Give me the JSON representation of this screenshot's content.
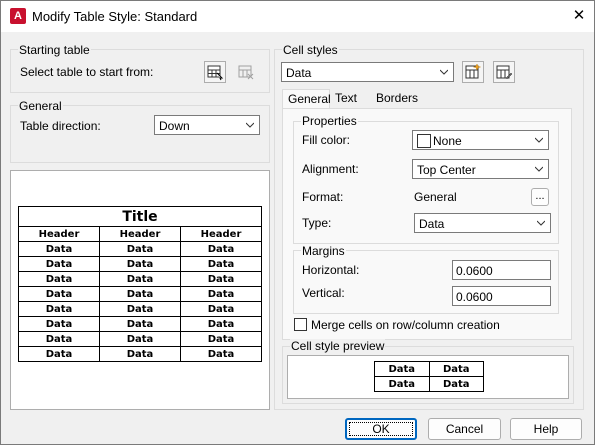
{
  "window": {
    "title": "Modify Table Style: Standard",
    "app_icon_letter": "A",
    "close_glyph": "✕"
  },
  "starting_table": {
    "group_label": "Starting table",
    "select_label": "Select table to start from:"
  },
  "general": {
    "group_label": "General",
    "direction_label": "Table direction:",
    "direction_value": "Down"
  },
  "preview": {
    "title": "Title",
    "headers": [
      "Header",
      "Header",
      "Header"
    ],
    "rows": [
      [
        "Data",
        "Data",
        "Data"
      ],
      [
        "Data",
        "Data",
        "Data"
      ],
      [
        "Data",
        "Data",
        "Data"
      ],
      [
        "Data",
        "Data",
        "Data"
      ],
      [
        "Data",
        "Data",
        "Data"
      ],
      [
        "Data",
        "Data",
        "Data"
      ],
      [
        "Data",
        "Data",
        "Data"
      ],
      [
        "Data",
        "Data",
        "Data"
      ]
    ]
  },
  "cell_styles": {
    "group_label": "Cell styles",
    "selected": "Data",
    "tabs": [
      "General",
      "Text",
      "Borders"
    ],
    "active_tab": "General"
  },
  "properties": {
    "group_label": "Properties",
    "fill_color_label": "Fill color:",
    "fill_color_value": "None",
    "alignment_label": "Alignment:",
    "alignment_value": "Top Center",
    "format_label": "Format:",
    "format_value": "General",
    "format_button": "...",
    "type_label": "Type:",
    "type_value": "Data"
  },
  "margins": {
    "group_label": "Margins",
    "horizontal_label": "Horizontal:",
    "horizontal_value": "0.0600",
    "vertical_label": "Vertical:",
    "vertical_value": "0.0600"
  },
  "merge_cells": {
    "label": "Merge cells on row/column creation",
    "checked": false
  },
  "cell_style_preview": {
    "group_label": "Cell style preview",
    "cells": [
      [
        "Data",
        "Data"
      ],
      [
        "Data",
        "Data"
      ]
    ]
  },
  "buttons": {
    "ok": "OK",
    "cancel": "Cancel",
    "help": "Help"
  },
  "colors": {
    "accent": "#0067c0",
    "app_icon": "#c8102e"
  }
}
